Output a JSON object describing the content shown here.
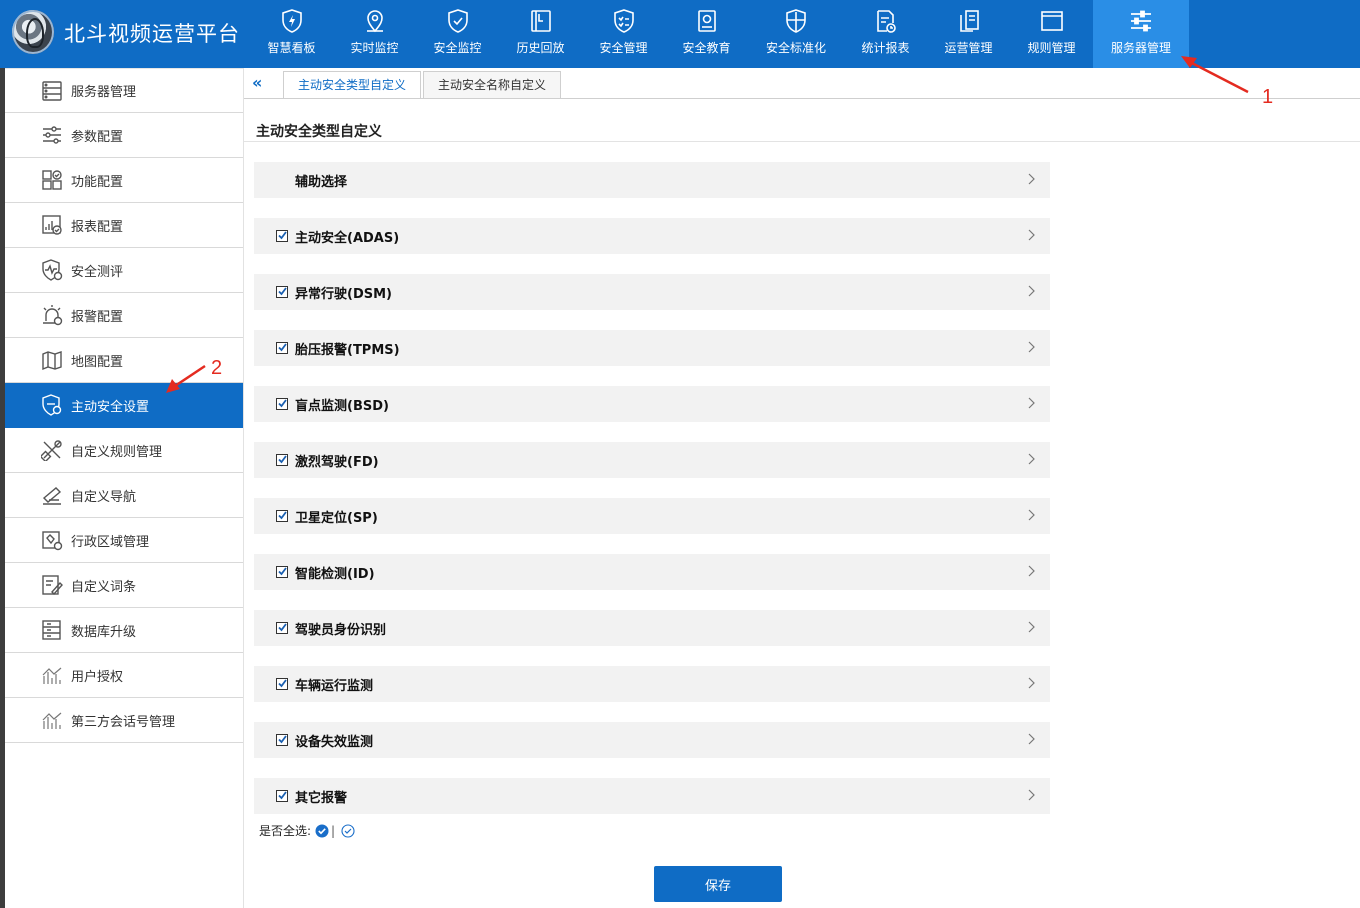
{
  "app": {
    "title": "北斗视频运营平台"
  },
  "topnav": [
    {
      "label": "智慧看板",
      "icon": "shield-lightning-icon"
    },
    {
      "label": "实时监控",
      "icon": "location-pin-icon"
    },
    {
      "label": "安全监控",
      "icon": "shield-check-icon"
    },
    {
      "label": "历史回放",
      "icon": "playback-icon"
    },
    {
      "label": "安全管理",
      "icon": "checklist-shield-icon"
    },
    {
      "label": "安全教育",
      "icon": "book-icon"
    },
    {
      "label": "安全标准化",
      "icon": "shield-grid-icon"
    },
    {
      "label": "统计报表",
      "icon": "report-clock-icon"
    },
    {
      "label": "运营管理",
      "icon": "documents-icon"
    },
    {
      "label": "规则管理",
      "icon": "window-icon"
    },
    {
      "label": "服务器管理",
      "icon": "sliders-icon",
      "active": true
    }
  ],
  "sidebar": [
    {
      "label": "服务器管理",
      "icon": "server-icon"
    },
    {
      "label": "参数配置",
      "icon": "sliders-icon"
    },
    {
      "label": "功能配置",
      "icon": "grid-check-icon"
    },
    {
      "label": "报表配置",
      "icon": "report-icon"
    },
    {
      "label": "安全测评",
      "icon": "shield-pulse-icon"
    },
    {
      "label": "报警配置",
      "icon": "alarm-icon"
    },
    {
      "label": "地图配置",
      "icon": "map-icon"
    },
    {
      "label": "主动安全设置",
      "icon": "shield-gear-icon",
      "active": true
    },
    {
      "label": "自定义规则管理",
      "icon": "rule-tools-icon"
    },
    {
      "label": "自定义导航",
      "icon": "navigation-icon"
    },
    {
      "label": "行政区域管理",
      "icon": "region-map-icon"
    },
    {
      "label": "自定义词条",
      "icon": "edit-text-icon"
    },
    {
      "label": "数据库升级",
      "icon": "database-icon"
    },
    {
      "label": "用户授权",
      "icon": "chart-bars-icon"
    },
    {
      "label": "第三方会话号管理",
      "icon": "chart-bars-icon"
    }
  ],
  "collapse_label": "«",
  "tabs": [
    {
      "label": "主动安全类型自定义",
      "active": true
    },
    {
      "label": "主动安全名称自定义",
      "active": false
    }
  ],
  "section_title": "主动安全类型自定义",
  "rows": [
    {
      "label": "辅助选择",
      "checkbox": false
    },
    {
      "label": "主动安全(ADAS)",
      "checkbox": true,
      "checked": true
    },
    {
      "label": "异常行驶(DSM)",
      "checkbox": true,
      "checked": true
    },
    {
      "label": "胎压报警(TPMS)",
      "checkbox": true,
      "checked": true
    },
    {
      "label": "盲点监测(BSD)",
      "checkbox": true,
      "checked": true
    },
    {
      "label": "激烈驾驶(FD)",
      "checkbox": true,
      "checked": true
    },
    {
      "label": "卫星定位(SP)",
      "checkbox": true,
      "checked": true
    },
    {
      "label": "智能检测(ID)",
      "checkbox": true,
      "checked": true
    },
    {
      "label": "驾驶员身份识别",
      "checkbox": true,
      "checked": true
    },
    {
      "label": "车辆运行监测",
      "checkbox": true,
      "checked": true
    },
    {
      "label": "设备失效监测",
      "checkbox": true,
      "checked": true
    },
    {
      "label": "其它报警",
      "checkbox": true,
      "checked": true
    }
  ],
  "select_all": {
    "label": "是否全选:",
    "separator": "|"
  },
  "save_label": "保存",
  "annotations": {
    "one": "1",
    "two": "2"
  },
  "colors": {
    "primary": "#0f6cc5",
    "active_tab_highlight": "#2a8ee6",
    "annotation": "#e42b20"
  }
}
